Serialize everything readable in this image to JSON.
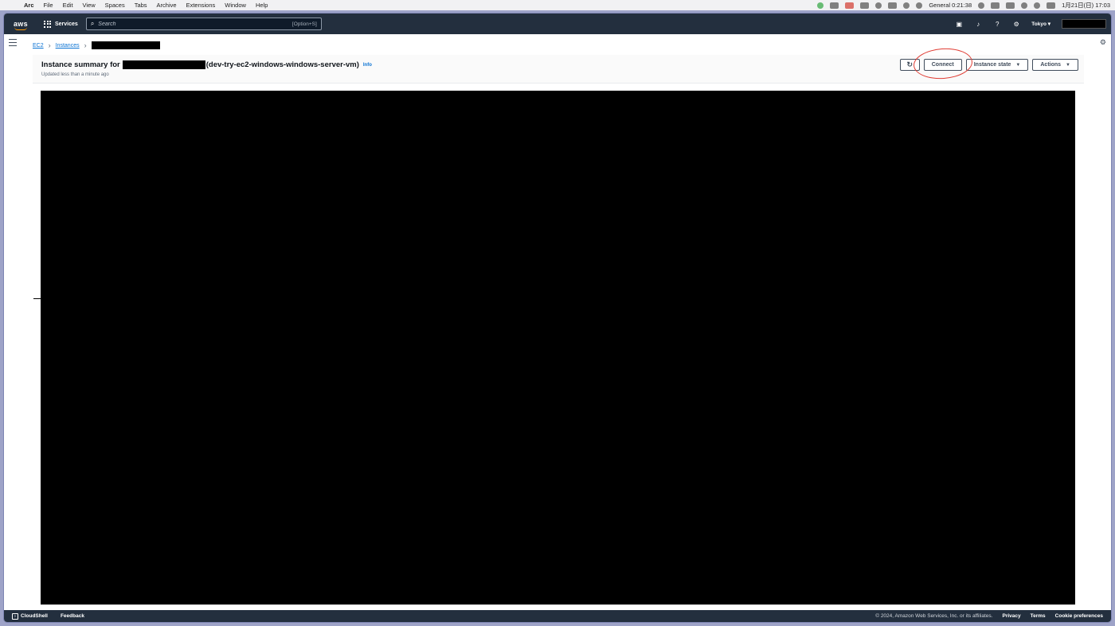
{
  "macos": {
    "app_name": "Arc",
    "menus": [
      "File",
      "Edit",
      "View",
      "Spaces",
      "Tabs",
      "Archive",
      "Extensions",
      "Window",
      "Help"
    ],
    "focus_label": "General",
    "timer": "0:21:38",
    "date_time": "1月21日(日) 17:03"
  },
  "aws_nav": {
    "logo_text": "aws",
    "services_label": "Services",
    "search_placeholder": "Search",
    "search_shortcut": "[Option+S]",
    "region": "Tokyo"
  },
  "breadcrumb": {
    "ec2": "EC2",
    "instances": "Instances"
  },
  "header": {
    "title_prefix": "Instance summary for",
    "title_suffix": "(dev-try-ec2-windows-windows-server-vm)",
    "info_label": "Info",
    "updated_text": "Updated less than a minute ago",
    "connect_label": "Connect",
    "instance_state_label": "Instance state",
    "actions_label": "Actions"
  },
  "footer": {
    "cloudshell_label": "CloudShell",
    "feedback_label": "Feedback",
    "copyright": "© 2024, Amazon Web Services, Inc. or its affiliates.",
    "privacy_label": "Privacy",
    "terms_label": "Terms",
    "cookie_label": "Cookie preferences"
  },
  "colors": {
    "aws_nav_bg": "#232f3e",
    "link_blue": "#0972d3",
    "annotation_red": "#e03c33",
    "desktop_bg": "#9ea3c8"
  }
}
